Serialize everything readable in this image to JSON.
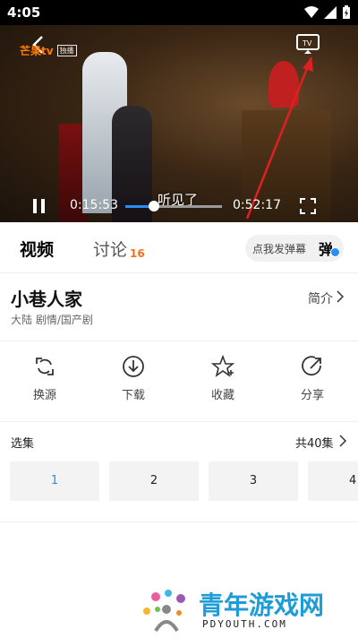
{
  "status_bar": {
    "time": "4:05"
  },
  "player": {
    "logo": "芒果tv",
    "logo_tag": "独播",
    "subtitle": "听见了",
    "current_time": "0:15:53",
    "total_time": "0:52:17",
    "progress": 0.3
  },
  "tabs": [
    {
      "label": "视频"
    },
    {
      "label": "讨论",
      "count": "16"
    }
  ],
  "danmu": {
    "placeholder": "点我发弹幕",
    "icon_glyph": "弹"
  },
  "show": {
    "title": "小巷人家",
    "genre": "大陆 剧情/国产剧",
    "intro_label": "简介"
  },
  "actions": [
    {
      "label": "换源",
      "icon": "switch-source-icon"
    },
    {
      "label": "下载",
      "icon": "download-icon"
    },
    {
      "label": "收藏",
      "icon": "star-icon"
    },
    {
      "label": "分享",
      "icon": "share-icon"
    }
  ],
  "episodes": {
    "label": "选集",
    "total": "共40集",
    "items": [
      "1",
      "2",
      "3",
      "4"
    ],
    "selected": "1"
  },
  "watermark": {
    "title": "青年游戏网",
    "url": "PDYOUTH.COM"
  },
  "colors": {
    "accent": "#2a8df0",
    "count": "#f07020",
    "arrow": "#e02020"
  }
}
